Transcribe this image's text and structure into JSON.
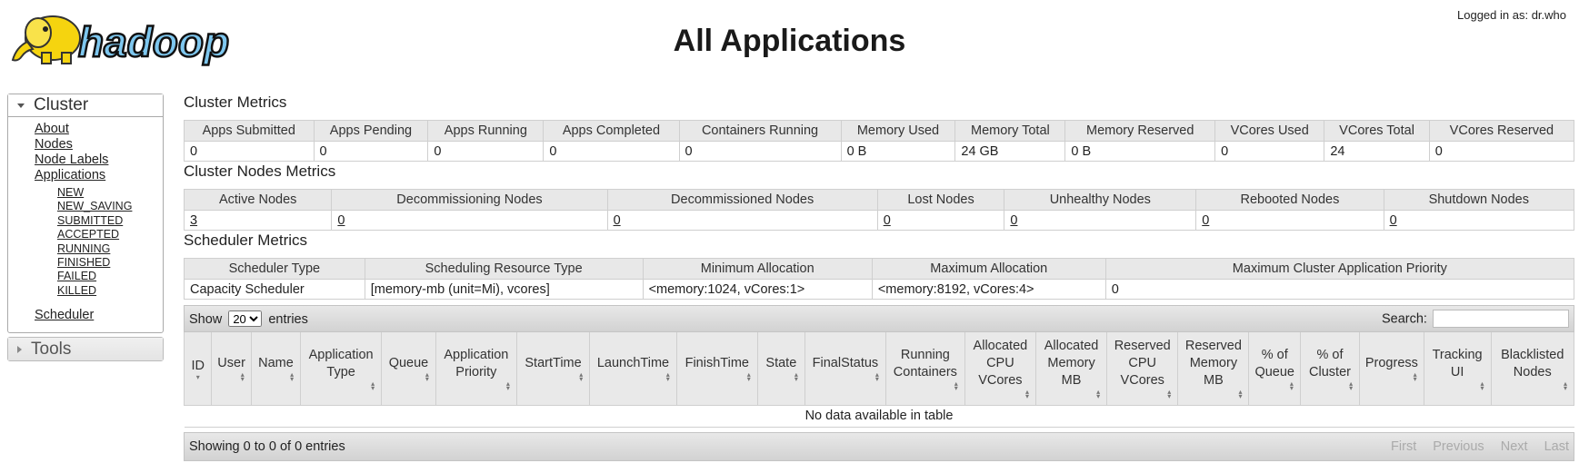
{
  "header": {
    "title": "All Applications",
    "login": "Logged in as: dr.who",
    "logo_text": "hadoop"
  },
  "sidebar": {
    "cluster_label": "Cluster",
    "links": [
      "About",
      "Nodes",
      "Node Labels",
      "Applications"
    ],
    "app_states": [
      "NEW",
      "NEW_SAVING",
      "SUBMITTED",
      "ACCEPTED",
      "RUNNING",
      "FINISHED",
      "FAILED",
      "KILLED"
    ],
    "scheduler_label": "Scheduler",
    "tools_label": "Tools"
  },
  "cluster_metrics": {
    "title": "Cluster Metrics",
    "headers": [
      "Apps Submitted",
      "Apps Pending",
      "Apps Running",
      "Apps Completed",
      "Containers Running",
      "Memory Used",
      "Memory Total",
      "Memory Reserved",
      "VCores Used",
      "VCores Total",
      "VCores Reserved"
    ],
    "values": [
      "0",
      "0",
      "0",
      "0",
      "0",
      "0 B",
      "24 GB",
      "0 B",
      "0",
      "24",
      "0"
    ]
  },
  "node_metrics": {
    "title": "Cluster Nodes Metrics",
    "headers": [
      "Active Nodes",
      "Decommissioning Nodes",
      "Decommissioned Nodes",
      "Lost Nodes",
      "Unhealthy Nodes",
      "Rebooted Nodes",
      "Shutdown Nodes"
    ],
    "values": [
      "3",
      "0",
      "0",
      "0",
      "0",
      "0",
      "0"
    ]
  },
  "scheduler_metrics": {
    "title": "Scheduler Metrics",
    "headers": [
      "Scheduler Type",
      "Scheduling Resource Type",
      "Minimum Allocation",
      "Maximum Allocation",
      "Maximum Cluster Application Priority"
    ],
    "values": [
      "Capacity Scheduler",
      "[memory-mb (unit=Mi), vcores]",
      "<memory:1024, vCores:1>",
      "<memory:8192, vCores:4>",
      "0"
    ]
  },
  "apps_table": {
    "show_label": "Show",
    "entries_label": "entries",
    "page_size": "20",
    "search_label": "Search:",
    "columns": [
      "ID",
      "User",
      "Name",
      "Application Type",
      "Queue",
      "Application Priority",
      "StartTime",
      "LaunchTime",
      "FinishTime",
      "State",
      "FinalStatus",
      "Running Containers",
      "Allocated CPU VCores",
      "Allocated Memory MB",
      "Reserved CPU VCores",
      "Reserved Memory MB",
      "% of Queue",
      "% of Cluster",
      "Progress",
      "Tracking UI",
      "Blacklisted Nodes"
    ],
    "empty_message": "No data available in table",
    "info": "Showing 0 to 0 of 0 entries",
    "pager": [
      "First",
      "Previous",
      "Next",
      "Last"
    ]
  }
}
